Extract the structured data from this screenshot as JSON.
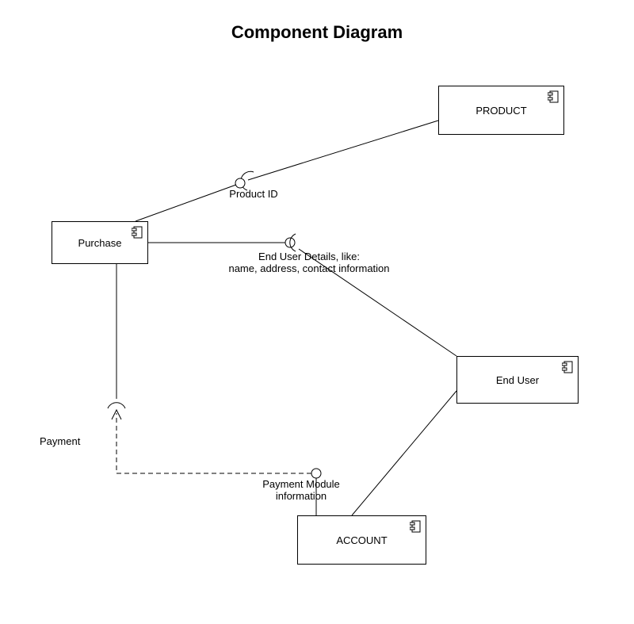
{
  "diagram": {
    "title": "Component Diagram",
    "components": {
      "product": {
        "label": "PRODUCT"
      },
      "purchase": {
        "label": "Purchase"
      },
      "end_user": {
        "label": "End User"
      },
      "account": {
        "label": "ACCOUNT"
      }
    },
    "interfaces": {
      "product_id": {
        "label": "Product ID"
      },
      "end_user_details_line1": "End User Details, like:",
      "end_user_details_line2": "name, address, contact information",
      "payment": {
        "label": "Payment"
      },
      "payment_module_line1": "Payment Module",
      "payment_module_line2": "information"
    }
  }
}
